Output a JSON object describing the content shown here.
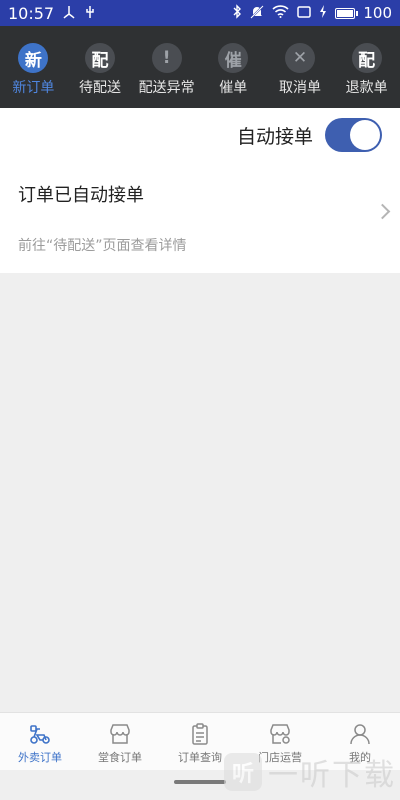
{
  "statusbar": {
    "time": "10:57",
    "icons_left": [
      "usb-fork-icon",
      "usb-icon"
    ],
    "icons_right": [
      "bluetooth-icon",
      "mute-icon",
      "wifi-icon",
      "screen-icon",
      "charging-icon"
    ],
    "battery": "100"
  },
  "top_tabs": [
    {
      "icon_char": "新",
      "label": "新订单",
      "active": true
    },
    {
      "icon_char": "配",
      "label": "待配送"
    },
    {
      "icon_char": "!",
      "label": "配送异常"
    },
    {
      "icon_char": "催",
      "label": "催单"
    },
    {
      "icon_char": "✕",
      "label": "取消单"
    },
    {
      "icon_char": "配",
      "label": "退款单"
    }
  ],
  "auto_accept": {
    "label": "自动接单",
    "enabled": true
  },
  "message": {
    "title": "订单已自动接单",
    "subtitle": "前往“待配送”页面查看详情"
  },
  "bottom_nav": [
    {
      "label": "外卖订单",
      "active": true,
      "icon": "scooter-icon"
    },
    {
      "label": "堂食订单",
      "icon": "storefront-icon"
    },
    {
      "label": "订单查询",
      "icon": "clipboard-icon"
    },
    {
      "label": "门店运营",
      "icon": "store-settings-icon"
    },
    {
      "label": "我的",
      "icon": "person-icon"
    }
  ],
  "watermark": {
    "logo_char": "听",
    "text": "一听下载"
  },
  "colors": {
    "statusbar": "#2b3ea8",
    "tabbar": "#2f3133",
    "accent": "#3e73c8",
    "toggle": "#3e5fb0"
  }
}
